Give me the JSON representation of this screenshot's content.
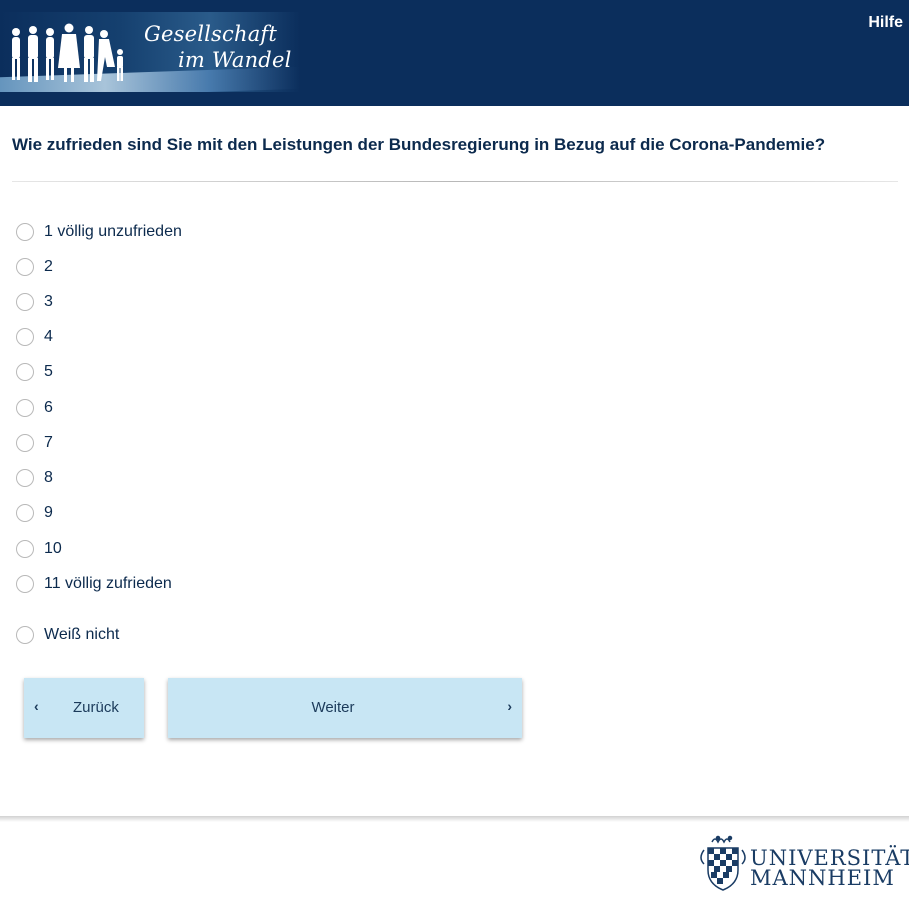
{
  "header": {
    "logo_line1": "Gesellschaft",
    "logo_line2": "im Wandel",
    "help_label": "Hilfe"
  },
  "question": {
    "text": "Wie zufrieden sind Sie mit den Leistungen der Bundesregierung in Bezug auf die Corona-Pandemie?"
  },
  "options": [
    {
      "label": "1 völlig unzufrieden",
      "selected": false
    },
    {
      "label": "2",
      "selected": false
    },
    {
      "label": "3",
      "selected": false
    },
    {
      "label": "4",
      "selected": false
    },
    {
      "label": "5",
      "selected": false
    },
    {
      "label": "6",
      "selected": false
    },
    {
      "label": "7",
      "selected": false
    },
    {
      "label": "8",
      "selected": false
    },
    {
      "label": "9",
      "selected": false
    },
    {
      "label": "10",
      "selected": false
    },
    {
      "label": "11 völlig zufrieden",
      "selected": false
    },
    {
      "label": "Weiß nicht",
      "selected": false
    }
  ],
  "nav": {
    "back_label": "Zurück",
    "next_label": "Weiter"
  },
  "footer": {
    "university_line1": "UNIVERSITÄT",
    "university_line2": "MANNHEIM"
  },
  "colors": {
    "header_bg": "#0b2e5c",
    "text": "#0c2a4d",
    "button_bg": "#c8e6f4"
  }
}
